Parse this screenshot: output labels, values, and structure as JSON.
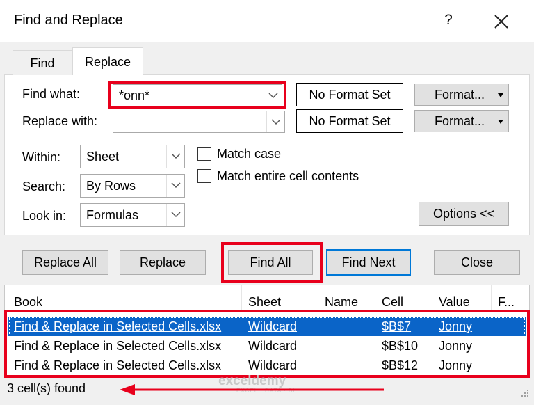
{
  "window": {
    "title": "Find and Replace",
    "help_label": "?"
  },
  "tabs": [
    {
      "label": "Find",
      "active": false
    },
    {
      "label": "Replace",
      "active": true
    }
  ],
  "form": {
    "find_label": "Find what:",
    "find_value": "*onn*",
    "replace_label": "Replace with:",
    "replace_value": "",
    "find_format_text": "No Format Set",
    "replace_format_text": "No Format Set",
    "format_button_label": "Format...",
    "within_label": "Within:",
    "within_value": "Sheet",
    "search_label": "Search:",
    "search_value": "By Rows",
    "lookin_label": "Look in:",
    "lookin_value": "Formulas",
    "match_case_label": "Match case",
    "match_case_checked": false,
    "match_entire_label": "Match entire cell contents",
    "match_entire_checked": false,
    "options_label": "Options <<"
  },
  "actions": {
    "replace_all": "Replace All",
    "replace": "Replace",
    "find_all": "Find All",
    "find_next": "Find Next",
    "close": "Close"
  },
  "results": {
    "columns": [
      "Book",
      "Sheet",
      "Name",
      "Cell",
      "Value",
      "F..."
    ],
    "rows": [
      {
        "book": "Find & Replace in Selected Cells.xlsx",
        "sheet": "Wildcard",
        "name": "",
        "cell": "$B$7",
        "value": "Jonny",
        "selected": true
      },
      {
        "book": "Find & Replace in Selected Cells.xlsx",
        "sheet": "Wildcard",
        "name": "",
        "cell": "$B$10",
        "value": "Jonny",
        "selected": false
      },
      {
        "book": "Find & Replace in Selected Cells.xlsx",
        "sheet": "Wildcard",
        "name": "",
        "cell": "$B$12",
        "value": "Jonny",
        "selected": false
      }
    ],
    "status": "3 cell(s) found"
  },
  "watermark": {
    "brand": "exceldemy",
    "tagline": "EXCEL · DATA · BI"
  },
  "colors": {
    "highlight_red": "#e8001c",
    "selection_blue": "#0a64c8",
    "focus_blue": "#0078d7"
  }
}
